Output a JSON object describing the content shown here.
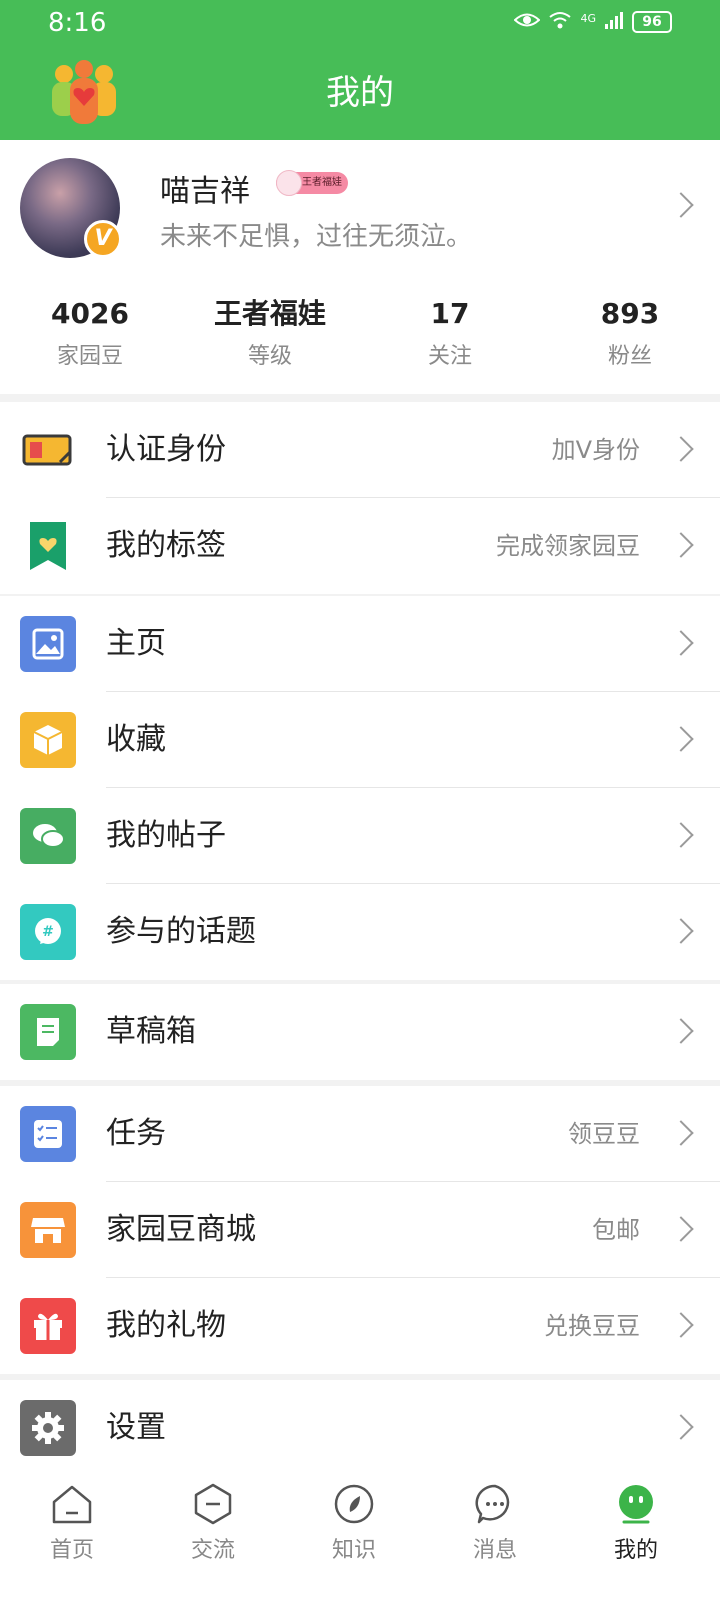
{
  "status_bar": {
    "time": "8:16",
    "network": "4G",
    "battery": "96"
  },
  "header": {
    "title": "我的"
  },
  "profile": {
    "name": "喵吉祥",
    "level_badge": "王者福娃",
    "signature": "未来不足惧，过往无须泣。",
    "verified_badge": "V"
  },
  "stats": [
    {
      "value": "4026",
      "label": "家园豆"
    },
    {
      "value": "王者福娃",
      "label": "等级"
    },
    {
      "value": "17",
      "label": "关注"
    },
    {
      "value": "893",
      "label": "粉丝"
    }
  ],
  "menu_groups": [
    [
      {
        "label": "认证身份",
        "sub": "加V身份",
        "icon": "id-card-icon"
      },
      {
        "label": "我的标签",
        "sub": "完成领家园豆",
        "icon": "bookmark-heart-icon"
      }
    ],
    [
      {
        "label": "主页",
        "sub": "",
        "icon": "image-icon"
      },
      {
        "label": "收藏",
        "sub": "",
        "icon": "box-icon"
      },
      {
        "label": "我的帖子",
        "sub": "",
        "icon": "chat-bubbles-icon"
      },
      {
        "label": "参与的话题",
        "sub": "",
        "icon": "hashtag-icon"
      }
    ],
    [
      {
        "label": "草稿箱",
        "sub": "",
        "icon": "draft-icon"
      }
    ],
    [
      {
        "label": "任务",
        "sub": "领豆豆",
        "icon": "task-list-icon"
      },
      {
        "label": "家园豆商城",
        "sub": "包邮",
        "icon": "shop-icon"
      },
      {
        "label": "我的礼物",
        "sub": "兑换豆豆",
        "icon": "gift-icon"
      }
    ],
    [
      {
        "label": "设置",
        "sub": "",
        "icon": "gear-icon"
      }
    ]
  ],
  "tabbar": [
    {
      "label": "首页",
      "icon": "home-icon"
    },
    {
      "label": "交流",
      "icon": "exchange-icon"
    },
    {
      "label": "知识",
      "icon": "knowledge-icon"
    },
    {
      "label": "消息",
      "icon": "message-icon"
    },
    {
      "label": "我的",
      "icon": "profile-face-icon",
      "active": true
    }
  ],
  "colors": {
    "brand_green": "#47bd57",
    "active_tab": "#3cb449"
  }
}
